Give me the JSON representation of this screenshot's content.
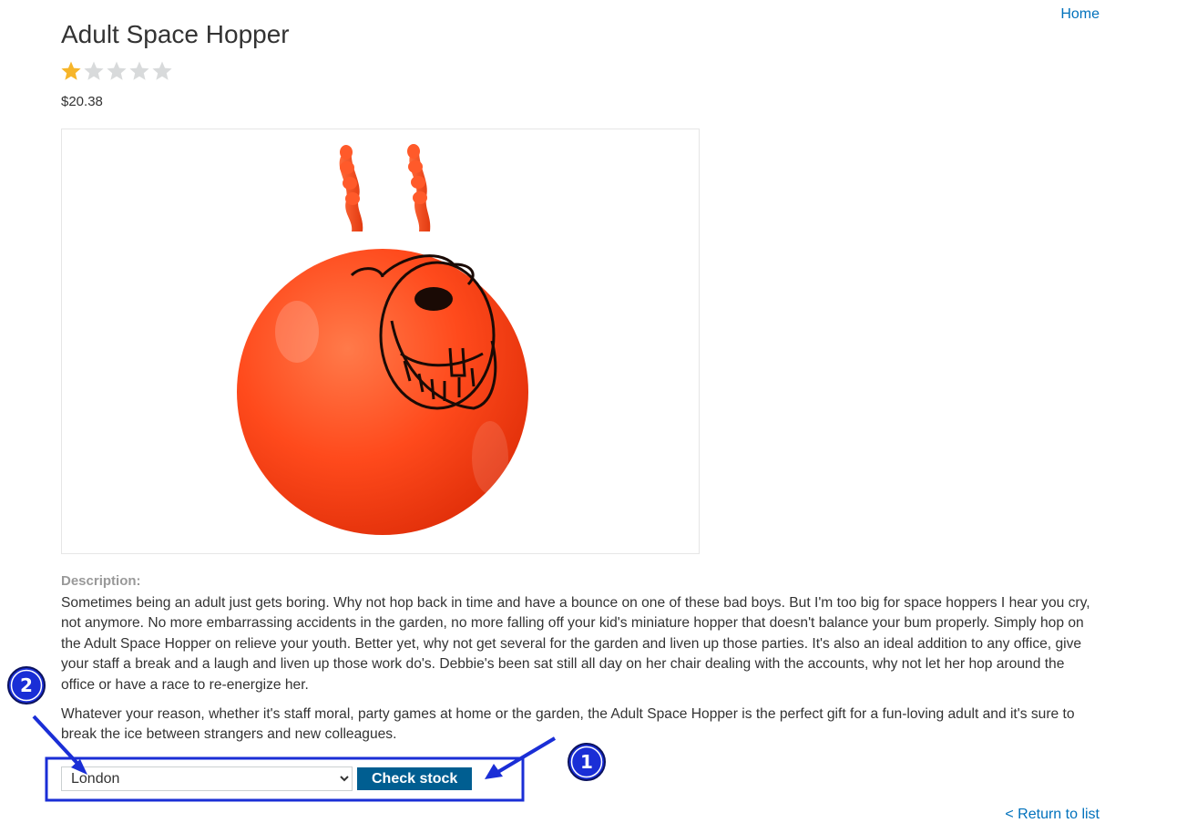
{
  "nav": {
    "home_label": "Home",
    "return_label": "< Return to list"
  },
  "product": {
    "title": "Adult Space Hopper",
    "rating": {
      "filled": 1,
      "total": 5
    },
    "price": "$20.38",
    "image_icon": "space-hopper-image",
    "description_label": "Description:",
    "description_p1": "Sometimes being an adult just gets boring. Why not hop back in time and have a bounce on one of these bad boys. But I'm too big for space hoppers I hear you cry, not anymore. No more embarrassing accidents in the garden, no more falling off your kid's miniature hopper that doesn't balance your bum properly. Simply hop on the Adult Space Hopper on relieve your youth. Better yet, why not get several for the garden and liven up those parties. It's also an ideal addition to any office, give your staff a break and a laugh and liven up those work do's. Debbie's been sat still all day on her chair dealing with the accounts, why not let her hop around the office or have a race to re-energize her.",
    "description_p2": "Whatever your reason, whether it's staff moral, party games at home or the garden, the Adult Space Hopper is the perfect gift for a fun-loving adult and it's sure to break the ice between strangers and new colleagues."
  },
  "stock": {
    "selected_store": "London",
    "check_label": "Check stock"
  },
  "annotations": {
    "marker_1": "1",
    "marker_2": "2",
    "color": "#1a2ed6"
  },
  "colors": {
    "link": "#0071bc",
    "button": "#005e91",
    "star_filled": "#f6b52a",
    "star_empty": "#d8dadb",
    "hopper": "#ff4a1c"
  }
}
